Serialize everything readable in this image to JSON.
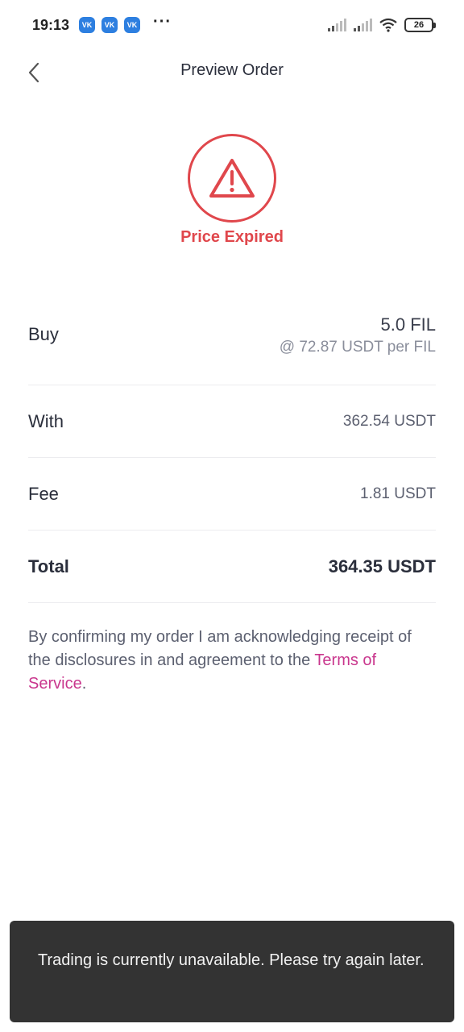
{
  "status_bar": {
    "time": "19:13",
    "notification_badges": [
      "VK",
      "VK",
      "VK"
    ],
    "overflow": "···",
    "battery": "26"
  },
  "header": {
    "title": "Preview Order",
    "back_icon": "chevron-left-icon"
  },
  "order_status": {
    "icon": "warning-triangle-icon",
    "label": "Price Expired",
    "color": "#e0474c"
  },
  "details": {
    "buy": {
      "label": "Buy",
      "amount": "5.0 FIL",
      "rate": "@ 72.87 USDT per FIL"
    },
    "with": {
      "label": "With",
      "value": "362.54 USDT"
    },
    "fee": {
      "label": "Fee",
      "value": "1.81 USDT"
    },
    "total": {
      "label": "Total",
      "value": "364.35 USDT"
    }
  },
  "disclaimer": {
    "text": "By confirming my order I am acknowledging receipt of the disclosures in and agreement to the ",
    "link": "Terms of Service",
    "suffix": ".",
    "link_color": "#c9368d"
  },
  "toast": {
    "message": "Trading is currently unavailable. Please try again later."
  }
}
